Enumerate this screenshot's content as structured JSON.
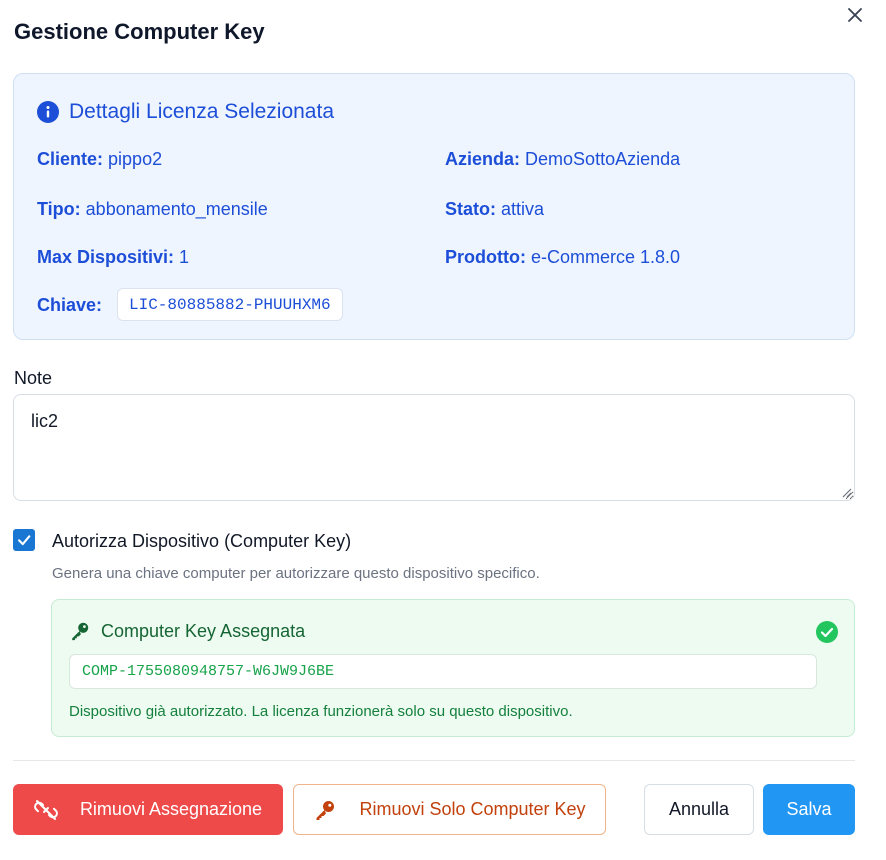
{
  "dialog": {
    "title": "Gestione Computer Key"
  },
  "details": {
    "title": "Dettagli Licenza Selezionata",
    "cliente": {
      "label": "Cliente:",
      "value": "pippo2"
    },
    "azienda": {
      "label": "Azienda:",
      "value": "DemoSottoAzienda"
    },
    "tipo": {
      "label": "Tipo:",
      "value": "abbonamento_mensile"
    },
    "stato": {
      "label": "Stato:",
      "value": "attiva"
    },
    "max_dispositivi": {
      "label": "Max Dispositivi:",
      "value": "1"
    },
    "prodotto": {
      "label": "Prodotto:",
      "value": "e-Commerce 1.8.0"
    },
    "chiave": {
      "label": "Chiave:",
      "value": "LIC-80885882-PHUUHXM6"
    }
  },
  "note": {
    "label": "Note",
    "value": "lic2"
  },
  "authorize": {
    "checked": true,
    "label": "Autorizza Dispositivo (Computer Key)",
    "help": "Genera una chiave computer per autorizzare questo dispositivo specifico."
  },
  "computer_key": {
    "title": "Computer Key Assegnata",
    "value": "COMP-1755080948757-W6JW9J6BE",
    "message": "Dispositivo già autorizzato. La licenza funzionerà solo su questo dispositivo."
  },
  "actions": {
    "remove_assignment": "Rimuovi Assegnazione",
    "remove_computer_key": "Rimuovi Solo Computer Key",
    "cancel": "Annulla",
    "save": "Salva"
  },
  "colors": {
    "info_blue": "#1d4ed8",
    "success_green": "#16a34a",
    "danger_red": "#ef4a4a",
    "warning_orange": "#c2410c",
    "primary_blue": "#2196f3"
  },
  "icons": {
    "close": "close-icon",
    "info": "info-icon",
    "key": "key-icon",
    "check_circle": "check-circle-icon",
    "unlink": "unlink-icon",
    "checkbox_check": "checkmark-icon"
  }
}
